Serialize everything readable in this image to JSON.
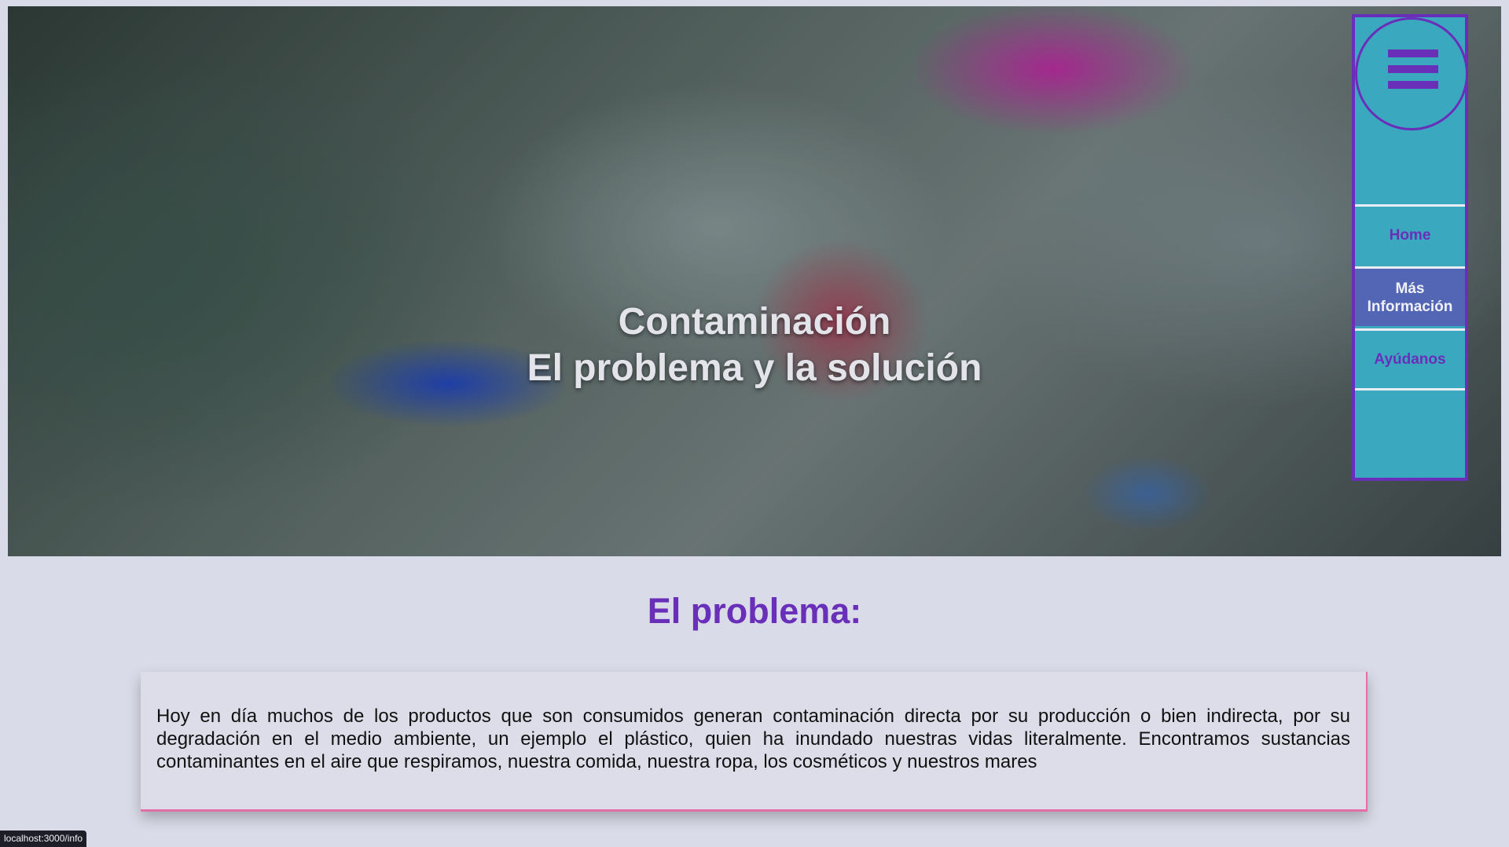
{
  "hero": {
    "title_line1": "Contaminación",
    "title_line2": "El problema y la solución"
  },
  "nav": {
    "menu_icon": "hamburger-menu-icon",
    "items": [
      {
        "label": "Home",
        "active": false
      },
      {
        "label": "Más Información",
        "active": true
      },
      {
        "label": "Ayúdanos",
        "active": false
      }
    ]
  },
  "problem": {
    "title": "El problema:",
    "text": "Hoy en día muchos de los productos que son consumidos generan contaminación directa por su producción o bien indirecta, por su degradación en el medio ambiente, un ejemplo el plástico, quien ha inundado nuestras vidas literalmente. Encontramos sustancias contaminantes en el aire que respiramos, nuestra comida, nuestra ropa, los cosméticos y nuestros mares"
  },
  "status_bar": {
    "url": "localhost:3000/info"
  },
  "colors": {
    "accent": "#6a2fb9",
    "nav_bg": "#3aa9c0",
    "nav_active": "#5266b5",
    "card_border": "#e26fa8",
    "page_bg": "#d9dbe8"
  }
}
